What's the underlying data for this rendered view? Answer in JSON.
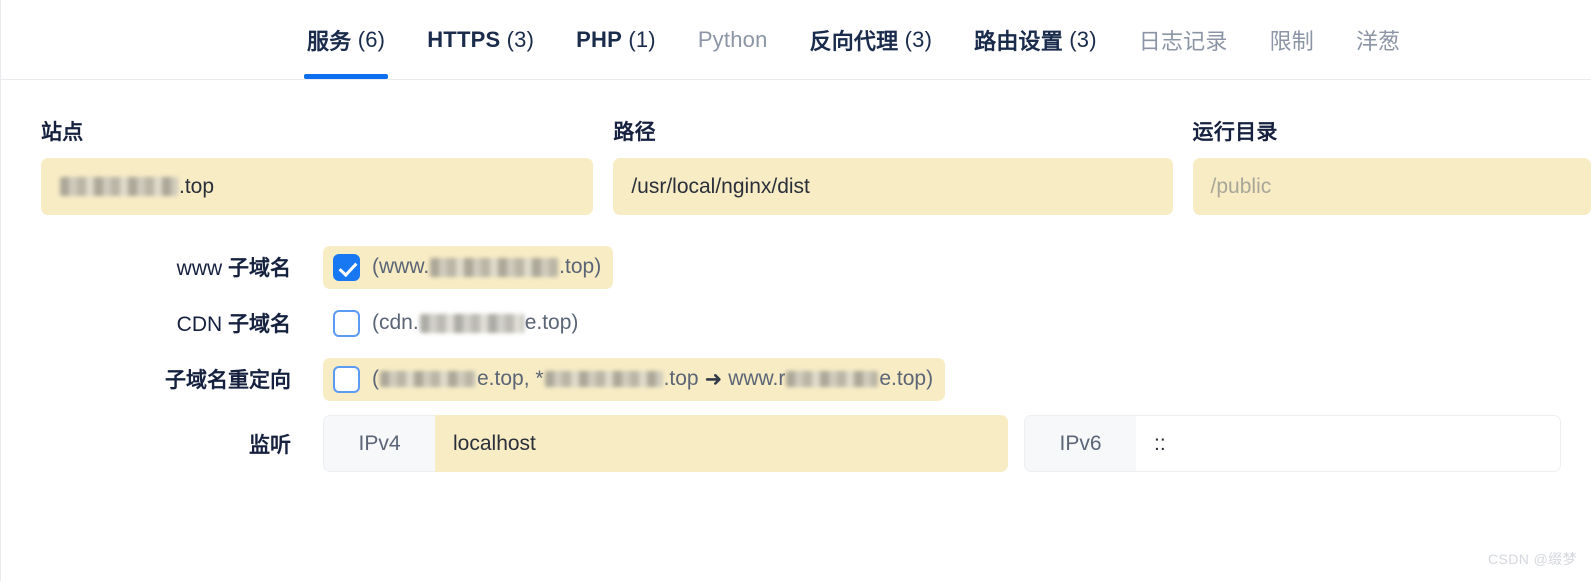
{
  "tabs": [
    {
      "label": "服务",
      "count": "(6)",
      "state": "active"
    },
    {
      "label": "HTTPS",
      "count": "(3)",
      "state": "strong"
    },
    {
      "label": "PHP",
      "count": "(1)",
      "state": "strong"
    },
    {
      "label": "Python",
      "count": "",
      "state": "muted"
    },
    {
      "label": "反向代理",
      "count": "(3)",
      "state": "strong"
    },
    {
      "label": "路由设置",
      "count": "(3)",
      "state": "strong"
    },
    {
      "label": "日志记录",
      "count": "",
      "state": "muted"
    },
    {
      "label": "限制",
      "count": "",
      "state": "muted"
    },
    {
      "label": "洋葱",
      "count": "",
      "state": "muted"
    }
  ],
  "fields": {
    "site": {
      "label": "站点",
      "value_suffix": ".top",
      "redacted": true
    },
    "path": {
      "label": "路径",
      "value": "/usr/local/nginx/dist"
    },
    "rundir": {
      "label": "运行目录",
      "placeholder": "/public",
      "value": ""
    }
  },
  "rows": {
    "www": {
      "label_latin": "www ",
      "label_cn": "子域名",
      "checked": true,
      "text_open": "(www.",
      "text_close": ".top)"
    },
    "cdn": {
      "label_latin": "CDN ",
      "label_cn": "子域名",
      "checked": false,
      "text_open": "(cdn.",
      "text_mid": "e.top)"
    },
    "redirect": {
      "label_cn": "子域名重定向",
      "checked": false,
      "seg1_open": "(",
      "seg1_close": "e.top, *",
      "seg2_close": ".top",
      "arrow": "➜",
      "seg3_open": "www.r",
      "seg3_close": "e.top)"
    },
    "listen": {
      "label_cn": "监听",
      "ipv4_addon": "IPv4",
      "ipv4_value": "localhost",
      "ipv6_addon": "IPv6",
      "ipv6_value": "::"
    }
  },
  "watermark": "CSDN @缀梦",
  "colors": {
    "accent": "#0b6ff0",
    "input_bg": "#f8ecc5",
    "checkbox_on": "#1877f2",
    "label_text": "#16213f"
  }
}
